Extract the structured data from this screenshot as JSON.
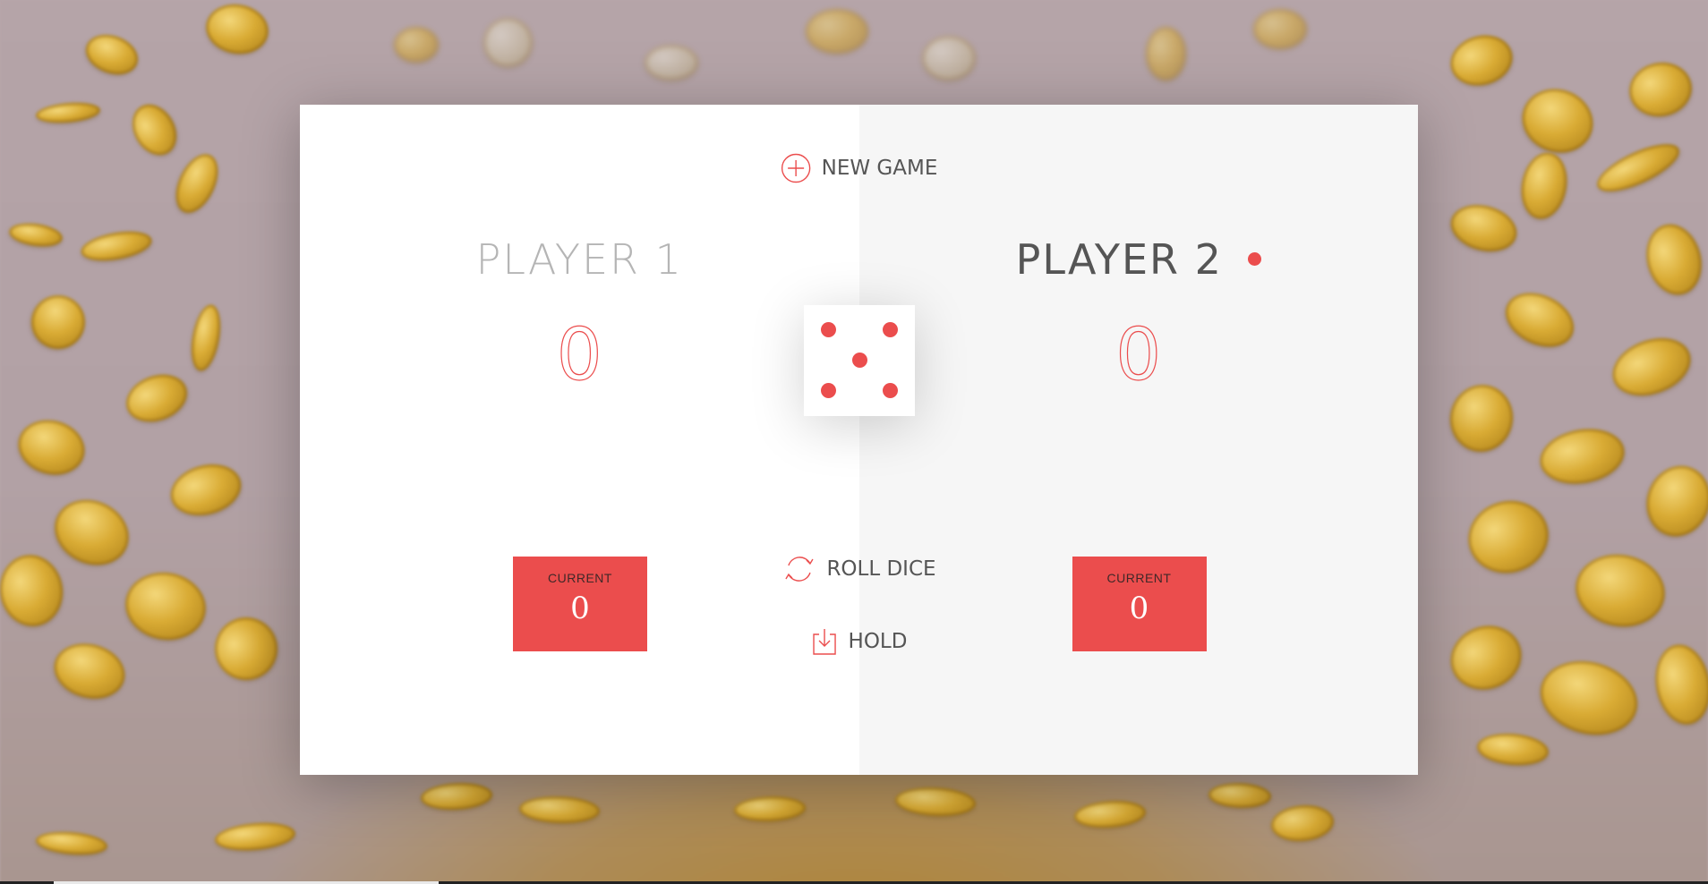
{
  "background": {
    "description_icon": "falling-gold-coins"
  },
  "buttons": {
    "new_game": "NEW GAME",
    "roll_dice": "ROLL DICE",
    "hold": "HOLD"
  },
  "players": [
    {
      "name": "PLAYER 1",
      "score": "0",
      "current_label": "CURRENT",
      "current_score": "0",
      "active": false
    },
    {
      "name": "PLAYER 2",
      "score": "0",
      "current_label": "CURRENT",
      "current_score": "0",
      "active": true
    }
  ],
  "dice": {
    "value": 5
  },
  "colors": {
    "accent": "#eb4d4d",
    "panel_left": "#ffffff",
    "panel_right": "#f6f6f6",
    "text_dark": "#555555",
    "text_light": "#b5b5b5"
  }
}
